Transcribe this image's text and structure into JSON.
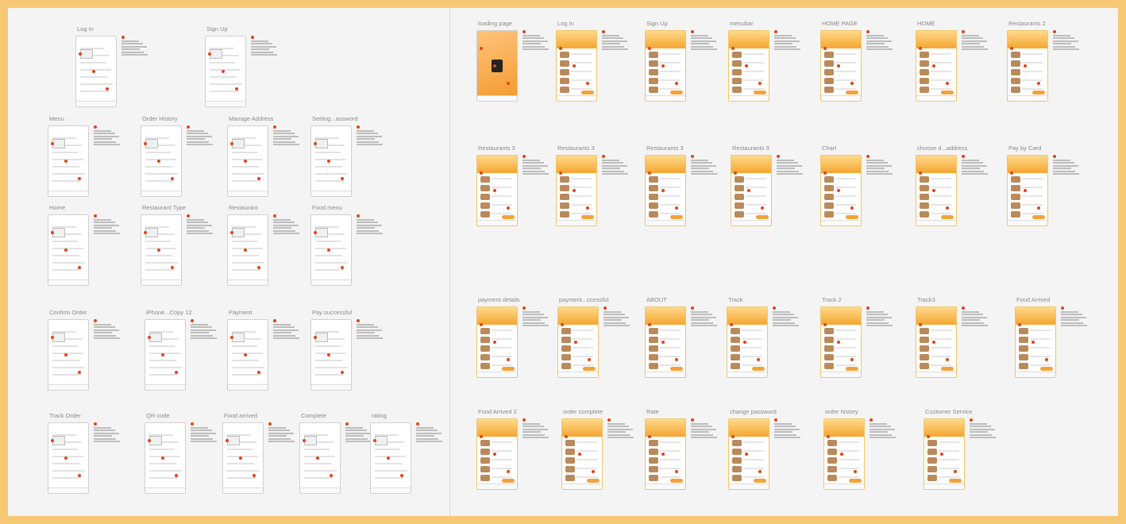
{
  "board": {
    "background": "#f7c873",
    "canvas_bg": "#f4f4f4",
    "accent": "#f2a23a",
    "marker": "#e1441a"
  },
  "wireframes_row1": [
    "Log In",
    "Sign Up"
  ],
  "wireframes_row2": [
    "Menu",
    "Order History",
    "Manage Address",
    "Setting...assword"
  ],
  "wireframes_row3": [
    "Home",
    "Restaurant Type",
    "Restaurant",
    "Food menu"
  ],
  "wireframes_row4": [
    "Confirm Order",
    "iPhone...Copy 12",
    "Payment",
    "Pay successful"
  ],
  "wireframes_row5": [
    "Track Order",
    "QR code",
    "Food arrived",
    "Complete",
    "rating"
  ],
  "hifi_row1": [
    "loading page",
    "Log In",
    "Sign Up",
    "menubar",
    "HOME PAGE",
    "HOME",
    "Restaurants 2"
  ],
  "hifi_row2": [
    "Restaurants 3",
    "Restaurants 3",
    "Restaurants 3",
    "Restaurants 3",
    "Chart",
    "choose d...address",
    "Pay by Card"
  ],
  "hifi_row3": [
    "payment details",
    "payment...ccessful",
    "ABOUT",
    "Track",
    "Track 2",
    "Track3",
    "Food Arrived"
  ],
  "hifi_row4": [
    "Food Arrived 2",
    "order complete",
    "Rate",
    "change password",
    "order history",
    "Customer Service"
  ]
}
